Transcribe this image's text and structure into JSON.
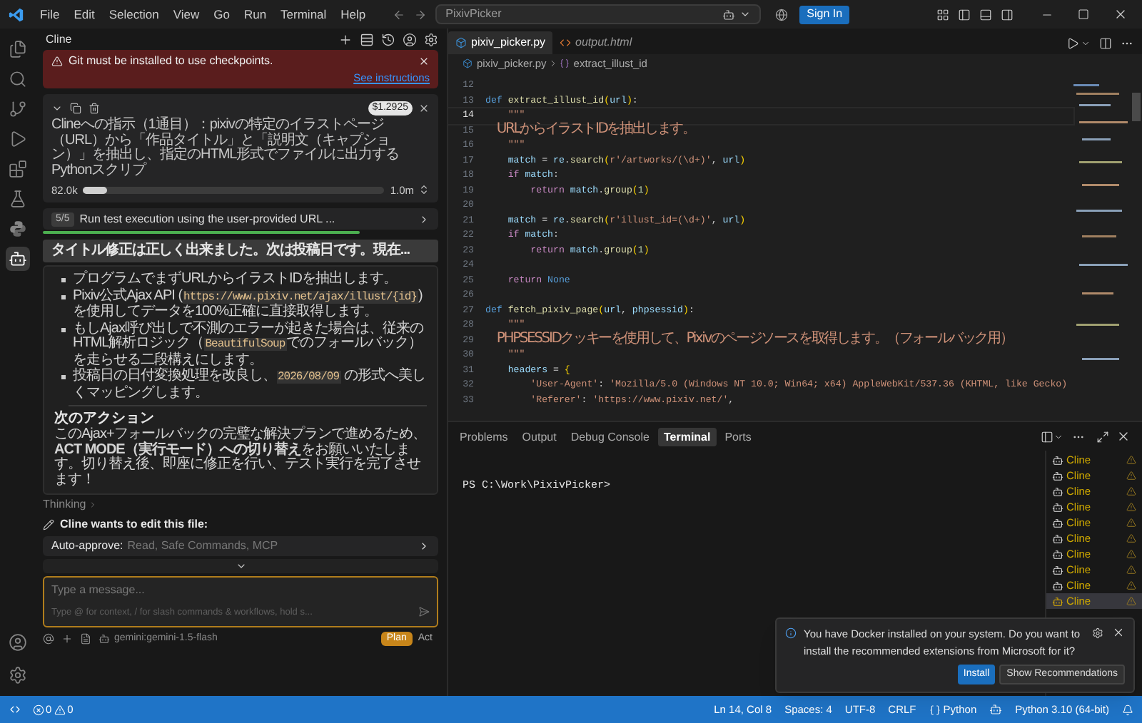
{
  "title_bar": {
    "menus": [
      "File",
      "Edit",
      "Selection",
      "View",
      "Go",
      "Run",
      "Terminal",
      "Help"
    ],
    "search": "PixivPicker",
    "sign_in": "Sign In"
  },
  "activity_bar": {
    "items": [
      {
        "kind": "files",
        "selected": false
      },
      {
        "kind": "search",
        "selected": false
      },
      {
        "kind": "scm",
        "selected": false
      },
      {
        "kind": "run",
        "selected": false
      },
      {
        "kind": "extensions",
        "selected": false
      },
      {
        "kind": "testing",
        "selected": false
      },
      {
        "kind": "python",
        "selected": false
      },
      {
        "kind": "cline",
        "selected": true
      }
    ]
  },
  "cline": {
    "title": "Cline",
    "banner": {
      "message": "Git must be installed to use checkpoints.",
      "link": "See instructions"
    },
    "task": {
      "cost": "$1.2925",
      "text": "Clineへの指示（1通目）：pixivの特定のイラストページ（URL）から「作品タイトル」と「説明文（キャプション）」を抽出し、指定のHTML形式でファイルに出力するPythonスクリプ",
      "tokens": "82.0k",
      "level": 0.08,
      "limit": "1.0m"
    },
    "step": {
      "count": "5/5",
      "label": "Run test execution using the user-provided URL ..."
    },
    "message": {
      "header": "タイトル修正は正しく出来ました。次は投稿日です。現在...",
      "bullets": [
        [
          {
            "kind": "text",
            "text": "プログラムでまずURLからイラストIDを抽出します。"
          }
        ],
        [
          {
            "kind": "text",
            "text": "Pixiv公式Ajax API ("
          },
          {
            "kind": "code",
            "text": "https://www.pixiv.net/ajax/illust/{id}"
          },
          {
            "kind": "text",
            "text": ") を使用してデータを100%正確に直接取得します。"
          }
        ],
        [
          {
            "kind": "text",
            "text": "もしAjax呼び出しで不測のエラーが起きた場合は、従来のHTML解析ロジック（"
          },
          {
            "kind": "code",
            "text": "BeautifulSoup"
          },
          {
            "kind": "text",
            "text": "でのフォールバック）を走らせる二段構えにします。"
          }
        ],
        [
          {
            "kind": "text",
            "text": "投稿日の日付変換処理を改良し、"
          },
          {
            "kind": "code",
            "text": "2026/08/09"
          },
          {
            "kind": "text",
            "text": " の形式へ美しくマッピングします。"
          }
        ]
      ],
      "next_heading": "次のアクション",
      "next_text": "このAjax+フォールバックの完璧な解決プランで進めるため、**ACT MODE（実行モード）への切り替え**をお願いいたします。切り替え後、即座に修正を行い、テスト実行を完了させます！"
    },
    "thinking": "Thinking",
    "edit_notice": "Cline wants to edit this file:",
    "auto_approve": {
      "label": "Auto-approve:",
      "value": "Read, Safe Commands, MCP"
    },
    "input": {
      "placeholder": "Type a message...",
      "hint": "Type @ for context, / for slash commands & workflows, hold s..."
    },
    "model": "gemini:gemini-1.5-flash",
    "modes": [
      {
        "label": "Plan",
        "selected": true
      },
      {
        "label": "Act",
        "selected": false
      }
    ]
  },
  "editor": {
    "tabs": [
      {
        "label": "pixiv_picker.py",
        "kind": "python",
        "selected": true
      },
      {
        "label": "output.html",
        "kind": "html",
        "selected": false
      }
    ],
    "breadcrumb": [
      "pixiv_picker.py",
      "extract_illust_id"
    ],
    "lines": [
      {
        "number": "12",
        "current": false
      },
      {
        "number": "13",
        "current": false,
        "tokens": [
          {
            "kind": "keyword",
            "text": "def "
          },
          {
            "kind": "function",
            "text": "extract_illust_id"
          },
          {
            "kind": "bracket",
            "text": "("
          },
          {
            "kind": "variable",
            "text": "url"
          },
          {
            "kind": "bracket",
            "text": ")"
          },
          {
            "kind": "punct",
            "text": ":"
          }
        ]
      },
      {
        "number": "14",
        "current": true,
        "tokens": [
          {
            "kind": "string",
            "text": "    \"\"\""
          }
        ]
      },
      {
        "number": "15",
        "current": false,
        "tokens": [
          {
            "kind": "docstring",
            "text": "    URLからイラストIDを抽出します。"
          }
        ]
      },
      {
        "number": "16",
        "current": false,
        "tokens": [
          {
            "kind": "string",
            "text": "    \"\"\""
          }
        ]
      },
      {
        "number": "17",
        "current": false,
        "tokens": [
          {
            "kind": "variable",
            "text": "    match"
          },
          {
            "kind": "punct",
            "text": " = "
          },
          {
            "kind": "variable",
            "text": "re"
          },
          {
            "kind": "punct",
            "text": "."
          },
          {
            "kind": "function",
            "text": "search"
          },
          {
            "kind": "bracket",
            "text": "("
          },
          {
            "kind": "string",
            "text": "r'/artworks/(\\d+)'"
          },
          {
            "kind": "punct",
            "text": ", "
          },
          {
            "kind": "variable",
            "text": "url"
          },
          {
            "kind": "bracket",
            "text": ")"
          }
        ]
      },
      {
        "number": "18",
        "current": false,
        "tokens": [
          {
            "kind": "control",
            "text": "    if "
          },
          {
            "kind": "variable",
            "text": "match"
          },
          {
            "kind": "punct",
            "text": ":"
          }
        ]
      },
      {
        "number": "19",
        "current": false,
        "tokens": [
          {
            "kind": "control",
            "text": "        return "
          },
          {
            "kind": "variable",
            "text": "match"
          },
          {
            "kind": "punct",
            "text": "."
          },
          {
            "kind": "function",
            "text": "group"
          },
          {
            "kind": "bracket",
            "text": "("
          },
          {
            "kind": "number",
            "text": "1"
          },
          {
            "kind": "bracket",
            "text": ")"
          }
        ]
      },
      {
        "number": "20",
        "current": false
      },
      {
        "number": "21",
        "current": false,
        "tokens": [
          {
            "kind": "variable",
            "text": "    match"
          },
          {
            "kind": "punct",
            "text": " = "
          },
          {
            "kind": "variable",
            "text": "re"
          },
          {
            "kind": "punct",
            "text": "."
          },
          {
            "kind": "function",
            "text": "search"
          },
          {
            "kind": "bracket",
            "text": "("
          },
          {
            "kind": "string",
            "text": "r'illust_id=(\\d+)'"
          },
          {
            "kind": "punct",
            "text": ", "
          },
          {
            "kind": "variable",
            "text": "url"
          },
          {
            "kind": "bracket",
            "text": ")"
          }
        ]
      },
      {
        "number": "22",
        "current": false,
        "tokens": [
          {
            "kind": "control",
            "text": "    if "
          },
          {
            "kind": "variable",
            "text": "match"
          },
          {
            "kind": "punct",
            "text": ":"
          }
        ]
      },
      {
        "number": "23",
        "current": false,
        "tokens": [
          {
            "kind": "control",
            "text": "        return "
          },
          {
            "kind": "variable",
            "text": "match"
          },
          {
            "kind": "punct",
            "text": "."
          },
          {
            "kind": "function",
            "text": "group"
          },
          {
            "kind": "bracket",
            "text": "("
          },
          {
            "kind": "number",
            "text": "1"
          },
          {
            "kind": "bracket",
            "text": ")"
          }
        ]
      },
      {
        "number": "24",
        "current": false
      },
      {
        "number": "25",
        "current": false,
        "tokens": [
          {
            "kind": "control",
            "text": "    return "
          },
          {
            "kind": "keyword",
            "text": "None"
          }
        ]
      },
      {
        "number": "26",
        "current": false
      },
      {
        "number": "27",
        "current": false,
        "tokens": [
          {
            "kind": "keyword",
            "text": "def "
          },
          {
            "kind": "function",
            "text": "fetch_pixiv_page"
          },
          {
            "kind": "bracket",
            "text": "("
          },
          {
            "kind": "variable",
            "text": "url"
          },
          {
            "kind": "punct",
            "text": ", "
          },
          {
            "kind": "variable",
            "text": "phpsessid"
          },
          {
            "kind": "bracket",
            "text": ")"
          },
          {
            "kind": "punct",
            "text": ":"
          }
        ]
      },
      {
        "number": "28",
        "current": false,
        "tokens": [
          {
            "kind": "string",
            "text": "    \"\"\""
          }
        ]
      },
      {
        "number": "29",
        "current": false,
        "tokens": [
          {
            "kind": "docstring",
            "text": "    PHPSESSIDクッキーを使用して、Pixivのページソースを取得します。（フォールバック用）"
          }
        ]
      },
      {
        "number": "30",
        "current": false,
        "tokens": [
          {
            "kind": "string",
            "text": "    \"\"\""
          }
        ]
      },
      {
        "number": "31",
        "current": false,
        "tokens": [
          {
            "kind": "variable",
            "text": "    headers"
          },
          {
            "kind": "punct",
            "text": " = "
          },
          {
            "kind": "bracket",
            "text": "{"
          }
        ]
      },
      {
        "number": "32",
        "current": false,
        "tokens": [
          {
            "kind": "string",
            "text": "        'User-Agent'"
          },
          {
            "kind": "punct",
            "text": ": "
          },
          {
            "kind": "string",
            "text": "'Mozilla/5.0 (Windows NT 10.0; Win64; x64) AppleWebKit/537.36 (KHTML, like Gecko)"
          }
        ]
      },
      {
        "number": "33",
        "current": false,
        "tokens": [
          {
            "kind": "string",
            "text": "        'Referer'"
          },
          {
            "kind": "punct",
            "text": ": "
          },
          {
            "kind": "string",
            "text": "'https://www.pixiv.net/'"
          },
          {
            "kind": "punct",
            "text": ","
          }
        ]
      }
    ]
  },
  "panel": {
    "tabs": [
      {
        "label": "Problems",
        "selected": false
      },
      {
        "label": "Output",
        "selected": false
      },
      {
        "label": "Debug Console",
        "selected": false
      },
      {
        "label": "Terminal",
        "selected": true
      },
      {
        "label": "Ports",
        "selected": false
      }
    ],
    "terminal": "PS C:\\Work\\PixivPicker>",
    "terminals": [
      {
        "label": "Cline",
        "selected": false
      },
      {
        "label": "Cline",
        "selected": false
      },
      {
        "label": "Cline",
        "selected": false
      },
      {
        "label": "Cline",
        "selected": false
      },
      {
        "label": "Cline",
        "selected": false
      },
      {
        "label": "Cline",
        "selected": false
      },
      {
        "label": "Cline",
        "selected": false
      },
      {
        "label": "Cline",
        "selected": false
      },
      {
        "label": "Cline",
        "selected": false
      },
      {
        "label": "Cline",
        "selected": true
      }
    ]
  },
  "notification": {
    "message": "You have Docker installed on your system. Do you want to install the recommended extensions from Microsoft for it?",
    "buttons": [
      "Install",
      "Show Recommendations"
    ]
  },
  "status_bar": {
    "errors": "0",
    "warnings": "0",
    "items": [
      "Ln 14, Col 8",
      "Spaces: 4",
      "UTF-8",
      "CRLF"
    ],
    "language": "Python",
    "interpreter": "Python 3.10 (64-bit)"
  }
}
